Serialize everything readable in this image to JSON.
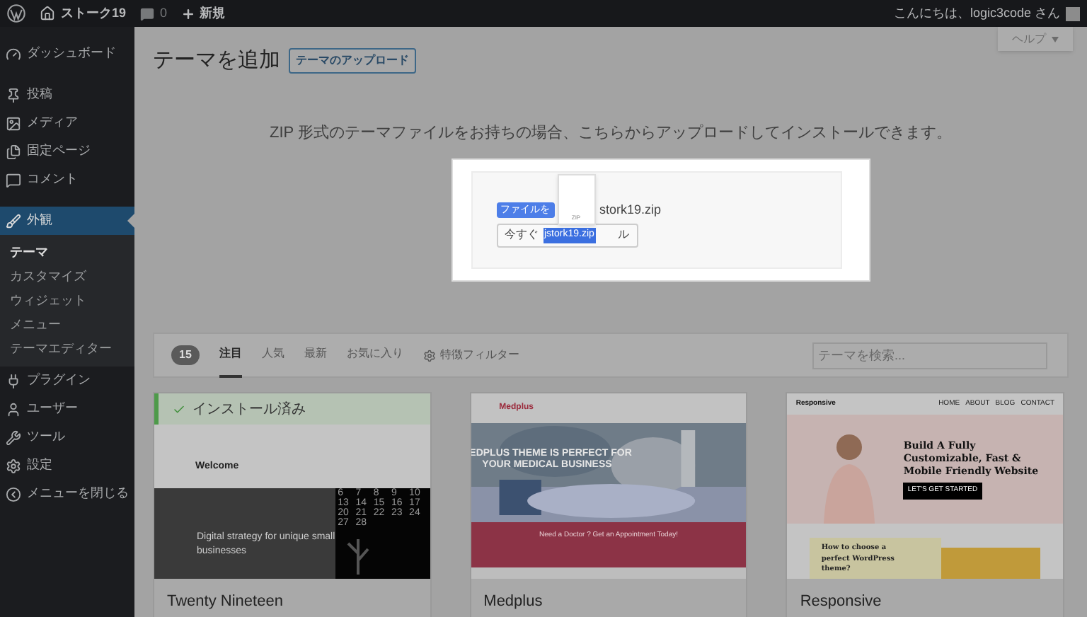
{
  "admin_bar": {
    "site_name": "ストーク19",
    "comments": "0",
    "new": "新規",
    "greeting": "こんにちは、logic3code さん"
  },
  "sidebar": {
    "items": [
      {
        "label": "ダッシュボード",
        "selected": false
      },
      {
        "label": "投稿",
        "selected": false
      },
      {
        "label": "メディア",
        "selected": false
      },
      {
        "label": "固定ページ",
        "selected": false
      },
      {
        "label": "コメント",
        "selected": false
      },
      {
        "label": "外観",
        "selected": true,
        "children": [
          {
            "label": "テーマ",
            "selected": true
          },
          {
            "label": "カスタマイズ",
            "selected": false
          },
          {
            "label": "ウィジェット",
            "selected": false
          },
          {
            "label": "メニュー",
            "selected": false
          },
          {
            "label": "テーマエディター",
            "selected": false
          }
        ]
      },
      {
        "label": "プラグイン",
        "selected": false
      },
      {
        "label": "ユーザー",
        "selected": false
      },
      {
        "label": "ツール",
        "selected": false
      },
      {
        "label": "設定",
        "selected": false
      },
      {
        "label": "メニューを閉じる",
        "selected": false
      }
    ]
  },
  "help_tab": "ヘルプ",
  "page_title": "テーマを追加",
  "upload_button": "テーマのアップロード",
  "upload": {
    "description": "ZIP 形式のテーマファイルをお持ちの場合、こちらからアップロードしてインストールできます。",
    "choose_file_button": "ファイルを",
    "file_name": "stork19.zip",
    "install_button_parts": [
      "今すぐ",
      "ル"
    ],
    "drag_icon_label": "ZIP",
    "drag_label": "jstork19.zip"
  },
  "filter_bar": {
    "count": "15",
    "tabs": [
      {
        "label": "注目",
        "selected": true
      },
      {
        "label": "人気",
        "selected": false
      },
      {
        "label": "最新",
        "selected": false
      },
      {
        "label": "お気に入り",
        "selected": false
      }
    ],
    "feature_filter": "特徴フィルター",
    "search": {
      "placeholder": "テーマを検索..."
    }
  },
  "themes": [
    {
      "kind": "nineteen",
      "name": "Twenty Nineteen",
      "installed": true,
      "installed_label": "インストール済み",
      "texts": [
        "Welcome",
        "Digital strategy for unique small businesses"
      ],
      "calendar": [
        "6",
        "7",
        "8",
        "9",
        "10",
        "13",
        "14",
        "15",
        "16",
        "17",
        "20",
        "21",
        "22",
        "23",
        "24",
        "27",
        "28"
      ]
    },
    {
      "kind": "medplus",
      "name": "Medplus",
      "installed": false,
      "texts": [
        "Medplus",
        "EDPLUS THEME IS PERFECT FOR",
        "YOUR MEDICAL BUSINESS",
        "Need a Doctor ? Get an Appointment Today!"
      ]
    },
    {
      "kind": "responsive",
      "name": "Responsive",
      "installed": false,
      "texts": [
        "Responsive",
        "Build A Fully Customizable, Fast & Mobile Friendly Website",
        "LET'S GET STARTED",
        "How to choose a perfect WordPress theme?"
      ],
      "nav": [
        "HOME",
        "ABOUT",
        "BLOG",
        "CONTACT"
      ]
    }
  ]
}
